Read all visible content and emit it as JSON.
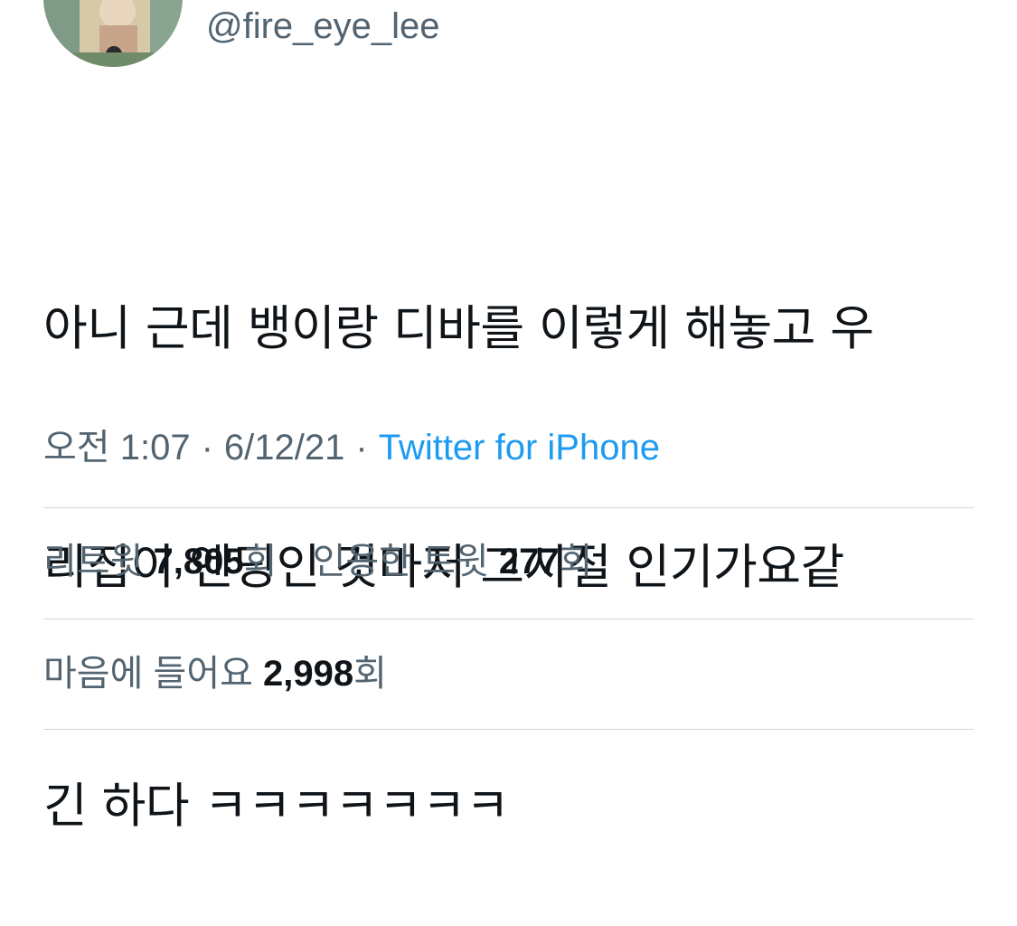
{
  "tweet": {
    "handle": "@fire_eye_lee",
    "text_lines": [
      "아니 근데 뱅이랑 디바를 이렇게 해놓고 우",
      "리집이 엔딩인 것마저 그시절 인기가요같",
      "긴 하다 ㅋㅋㅋㅋㅋㅋㅋ"
    ],
    "time": "오전 1:07",
    "date": "6/12/21",
    "separator": "·",
    "source": "Twitter for iPhone"
  },
  "stats": {
    "retweets_label": "리트윗",
    "retweets_count": "7,805",
    "retweets_unit": "회",
    "quotes_label": "인용한 트윗",
    "quotes_count": "277",
    "quotes_unit": "회",
    "likes_label": "마음에 들어요",
    "likes_count": "2,998",
    "likes_unit": "회"
  },
  "colors": {
    "text": "#0f1419",
    "secondary": "#536471",
    "link": "#1d9bf0",
    "divider": "#cfd9de"
  }
}
